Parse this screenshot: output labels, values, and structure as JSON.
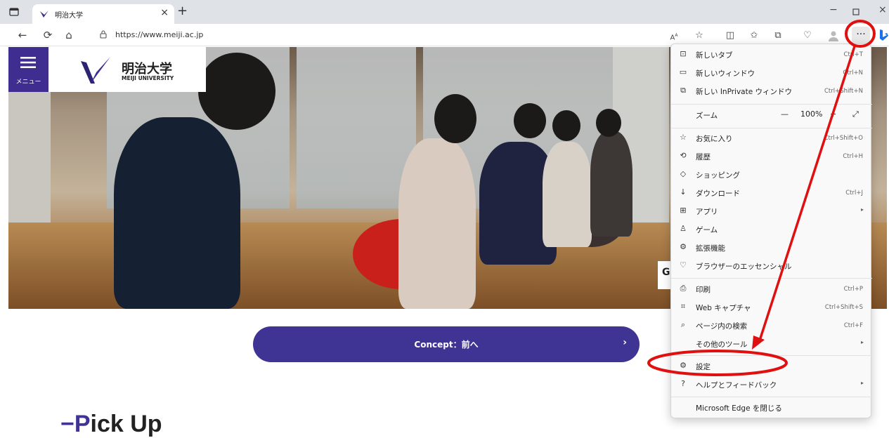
{
  "browser": {
    "tab_title": "明治大学",
    "tab_close": "×",
    "new_tab": "+",
    "window_controls": [
      "−",
      "×"
    ],
    "url_text": "https://www.meiji.ac.jp",
    "more_label": "···",
    "toolbar_text_icon": "Aᴀ"
  },
  "site": {
    "menu_label": "メニュー",
    "logo_jp": "明治大学",
    "logo_en": "MEIJI UNIVERSITY",
    "concept_label": "Concept：前へ",
    "concept_chevron": "›",
    "pickup_dash": "−",
    "pickup_p": "P",
    "pickup_rest": "ick Up",
    "hero_chip": "G"
  },
  "context_menu": {
    "items": [
      {
        "icon": "new-tab-icon",
        "glyph": "⊡",
        "label": "新しいタブ",
        "shortcut": "Ctrl+T"
      },
      {
        "icon": "new-window-icon",
        "glyph": "▭",
        "label": "新しいウィンドウ",
        "shortcut": "Ctrl+N"
      },
      {
        "icon": "inprivate-icon",
        "glyph": "⧉",
        "label": "新しい InPrivate ウィンドウ",
        "shortcut": "Ctrl+Shift+N"
      },
      {
        "icon": "zoom-icon",
        "glyph": "",
        "label": "ズーム",
        "shortcut": ""
      },
      {
        "icon": "favorites-icon",
        "glyph": "☆",
        "label": "お気に入り",
        "shortcut": "Ctrl+Shift+O"
      },
      {
        "icon": "history-icon",
        "glyph": "⟲",
        "label": "履歴",
        "shortcut": "Ctrl+H"
      },
      {
        "icon": "shopping-icon",
        "glyph": "◇",
        "label": "ショッピング",
        "shortcut": ""
      },
      {
        "icon": "download-icon",
        "glyph": "↓",
        "label": "ダウンロード",
        "shortcut": "Ctrl+J"
      },
      {
        "icon": "apps-icon",
        "glyph": "⊞",
        "label": "アプリ",
        "shortcut": ""
      },
      {
        "icon": "games-icon",
        "glyph": "♙",
        "label": "ゲーム",
        "shortcut": ""
      },
      {
        "icon": "extensions-icon",
        "glyph": "⚙",
        "label": "拡張機能",
        "shortcut": ""
      },
      {
        "icon": "essentials-icon",
        "glyph": "♡",
        "label": "ブラウザーのエッセンシャル",
        "shortcut": ""
      },
      {
        "icon": "print-icon",
        "glyph": "⎙",
        "label": "印刷",
        "shortcut": "Ctrl+P"
      },
      {
        "icon": "web-capture-icon",
        "glyph": "⌗",
        "label": "Web キャプチャ",
        "shortcut": "Ctrl+Shift+S"
      },
      {
        "icon": "find-icon",
        "glyph": "⌕",
        "label": "ページ内の検索",
        "shortcut": "Ctrl+F"
      },
      {
        "icon": "",
        "glyph": "",
        "label": "その他のツール",
        "shortcut": ""
      },
      {
        "icon": "settings-icon",
        "glyph": "⚙",
        "label": "設定",
        "shortcut": ""
      },
      {
        "icon": "help-icon",
        "glyph": "?",
        "label": "ヘルプとフィードバック",
        "shortcut": ""
      },
      {
        "icon": "",
        "glyph": "",
        "label": "Microsoft Edge を閉じる",
        "shortcut": ""
      }
    ],
    "zoom_minus": "—",
    "zoom_value": "100%",
    "zoom_plus": "+",
    "zoom_expand": "⤢",
    "submenu_arrow": "▸"
  },
  "annotation_colors": {
    "highlight": "#e01010"
  }
}
